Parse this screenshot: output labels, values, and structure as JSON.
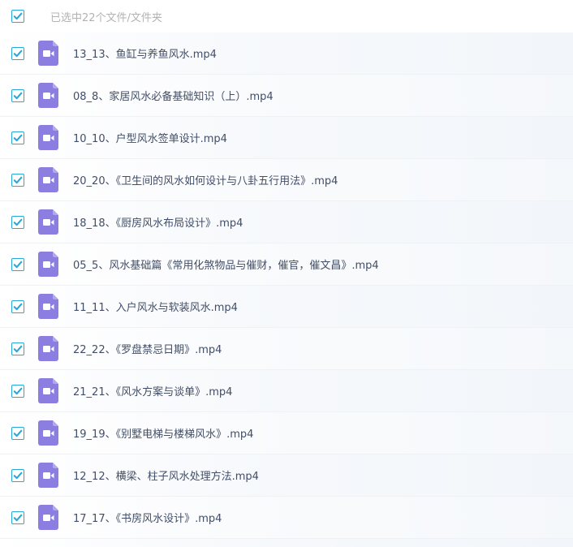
{
  "header": {
    "summary": "已选中22个文件/文件夹",
    "checked": true
  },
  "colors": {
    "checkbox_border": "#26a8d8",
    "checkmark": "#26a8d8",
    "video_icon": "#8b7ee0",
    "filename_text": "#424e67",
    "summary_text": "#b3b3b3"
  },
  "icons": {
    "checkbox": "check-icon",
    "file": "video-file-icon"
  },
  "files": [
    {
      "name": "13_13、鱼缸与养鱼风水.mp4",
      "checked": true
    },
    {
      "name": "08_8、家居风水必备基础知识（上）.mp4",
      "checked": true
    },
    {
      "name": "10_10、户型风水签单设计.mp4",
      "checked": true
    },
    {
      "name": "20_20、《卫生间的风水如何设计与八卦五行用法》.mp4",
      "checked": true
    },
    {
      "name": "18_18、《厨房风水布局设计》.mp4",
      "checked": true
    },
    {
      "name": "05_5、风水基础篇《常用化煞物品与催财，催官，催文昌》.mp4",
      "checked": true
    },
    {
      "name": "11_11、入户风水与软装风水.mp4",
      "checked": true
    },
    {
      "name": "22_22、《罗盘禁忌日期》.mp4",
      "checked": true
    },
    {
      "name": "21_21、《风水方案与谈单》.mp4",
      "checked": true
    },
    {
      "name": "19_19、《别墅电梯与楼梯风水》.mp4",
      "checked": true
    },
    {
      "name": "12_12、横梁、柱子风水处理方法.mp4",
      "checked": true
    },
    {
      "name": "17_17、《书房风水设计》.mp4",
      "checked": true
    }
  ]
}
